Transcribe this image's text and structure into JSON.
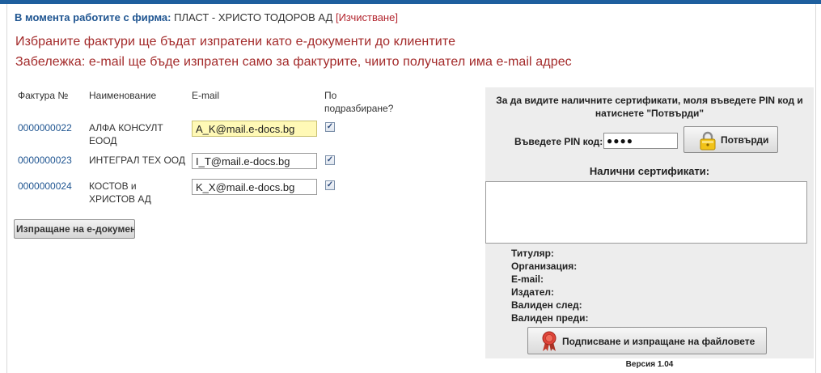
{
  "header": {
    "company_label": "В момента работите с фирма:",
    "company_name": "ПЛАСТ - ХРИСТО ТОДОРОВ АД",
    "change_link": "[Изчистване]"
  },
  "notices": {
    "line1": "Избраните фактури ще бъдат изпратени като е-документи до клиентите",
    "line2": "Забележка: e-mail ще бъде изпратен само за фактурите, чиито получател има e-mail адрес"
  },
  "table": {
    "headers": {
      "invoice": "Фактура №",
      "name": "Наименование",
      "email": "E-mail",
      "default_line1": "По",
      "default_line2": "подразбиране?"
    },
    "rows": [
      {
        "invoice": "0000000022",
        "name_line1": "АЛФА КОНСУЛТ",
        "name_line2": "ЕООД",
        "email": "A_K@mail.e-docs.bg",
        "default": true
      },
      {
        "invoice": "0000000023",
        "name_line1": "ИНТЕГРАЛ ТЕХ ООД",
        "name_line2": "",
        "email": "I_T@mail.e-docs.bg",
        "default": true
      },
      {
        "invoice": "0000000024",
        "name_line1": "КОСТОВ и",
        "name_line2": "ХРИСТОВ АД",
        "email": "K_X@mail.e-docs.bg",
        "default": true
      }
    ]
  },
  "send_button": "Изпращане на е-документи",
  "cert_panel": {
    "message_line1": "За да видите наличните сертификати, моля въведете PIN код и",
    "message_line2": "натиснете \"Потвърди\"",
    "pin_label": "Въведете PIN код:",
    "pin_value": "●●●●",
    "confirm_button": "Потвърди",
    "certs_title": "Налични сертификати:",
    "details": {
      "holder": "Титуляр:",
      "organization": "Организация:",
      "email": "E-mail:",
      "issuer": "Издател:",
      "valid_from": "Валиден след:",
      "valid_to": "Валиден преди:"
    },
    "sign_button": "Подписване и изпращане на файловете",
    "version": "Версия 1.04"
  },
  "colors": {
    "top_bar": "#1e5f9e",
    "notice_text": "#a32a2a",
    "link_blue": "#1f5591",
    "panel_bg": "#ededed"
  },
  "icons": {
    "confirm": "lock-icon",
    "sign": "seal-icon"
  }
}
